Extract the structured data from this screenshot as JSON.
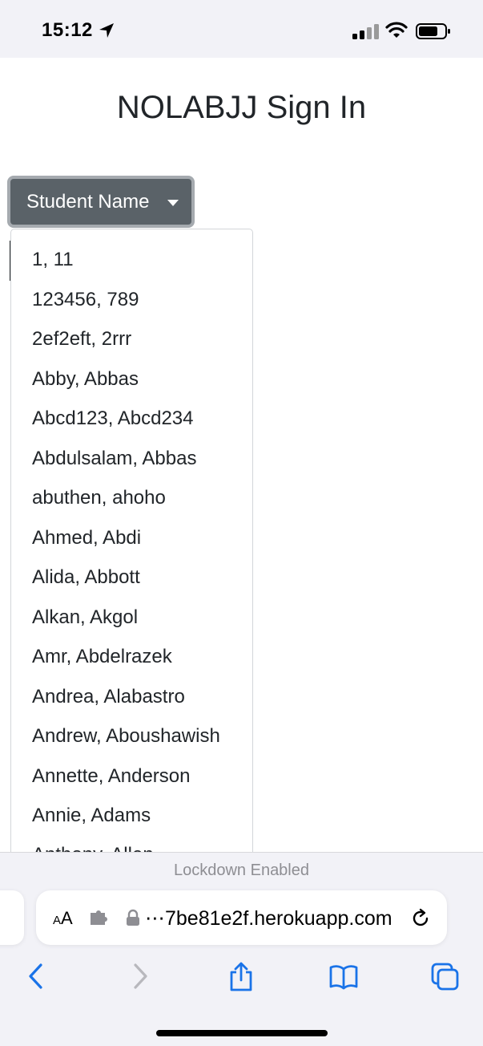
{
  "status": {
    "time": "15:12"
  },
  "page": {
    "title": "NOLABJJ Sign In"
  },
  "dropdown": {
    "label": "Student Name",
    "items": [
      "1, 11",
      "123456, 789",
      "2ef2eft, 2rrr",
      "Abby, Abbas",
      "Abcd123, Abcd234",
      "Abdulsalam, Abbas",
      "abuthen, ahoho",
      "Ahmed, Abdi",
      "Alida, Abbott",
      "Alkan, Akgol",
      "Amr, Abdelrazek",
      "Andrea, Alabastro",
      "Andrew, Aboushawish",
      "Annette, Anderson",
      "Annie, Adams",
      "Anthony, Allen"
    ]
  },
  "browser": {
    "lockdown_text": "Lockdown Enabled",
    "aa_small": "A",
    "aa_large": "A",
    "url": "⋯7be81e2f.herokuapp.com"
  },
  "icons": {
    "location": "location-arrow-icon",
    "signal": "cellular-signal-icon",
    "wifi": "wifi-icon",
    "battery": "battery-icon",
    "caret": "caret-down-icon",
    "extension": "extension-icon",
    "lock": "lock-icon",
    "reload": "reload-icon",
    "back": "back-chevron-icon",
    "forward": "forward-chevron-icon",
    "share": "share-icon",
    "bookmarks": "bookmarks-icon",
    "tabs": "tabs-icon"
  },
  "colors": {
    "button_bg": "#5a6268",
    "button_focus_ring": "#a5aaaf",
    "ios_blue": "#1a73e8",
    "ios_bar_bg": "#f2f2f7"
  }
}
